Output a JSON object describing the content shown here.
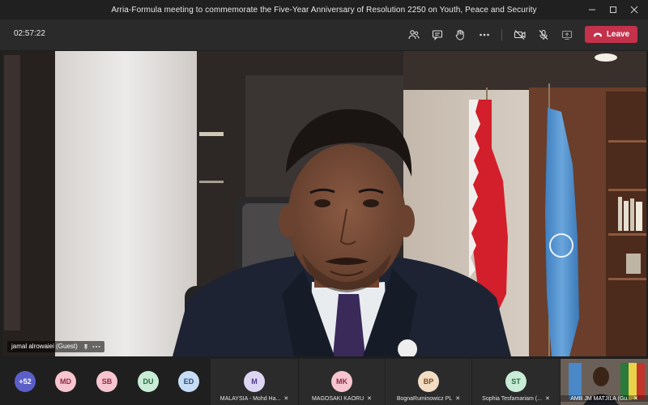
{
  "window": {
    "title": "Arria-Formula meeting to commemorate the Five-Year Anniversary of Resolution 2250 on Youth, Peace and Security"
  },
  "toolbar": {
    "timer": "02:57:22",
    "leave_label": "Leave",
    "icons": [
      "people-icon",
      "chat-icon",
      "raise-hand-icon",
      "more-icon",
      "camera-off-icon",
      "mic-off-icon",
      "share-icon"
    ],
    "leave_color": "#c4314b"
  },
  "main_speaker": {
    "name_tag": "jamal alrowaiei (Guest)"
  },
  "strip": {
    "overflow_count": "+52",
    "avatars": [
      {
        "initials": "MD",
        "bg": "#f7c5d0",
        "fg": "#8a2a45"
      },
      {
        "initials": "SB",
        "bg": "#f7c5d0",
        "fg": "#8a2a45"
      },
      {
        "initials": "DU",
        "bg": "#c9ecd6",
        "fg": "#2a6a45"
      },
      {
        "initials": "ED",
        "bg": "#c7dcf5",
        "fg": "#2a4a7a"
      }
    ],
    "tiles": [
      {
        "initials": "M",
        "name": "MALAYSIA - Mohd Ha...",
        "bg": "#ddd6f3",
        "fg": "#4b3a8a"
      },
      {
        "initials": "MK",
        "name": "MAGOSAKI KAORU",
        "bg": "#f7c5d0",
        "fg": "#8a2a45"
      },
      {
        "initials": "BP",
        "name": "BognaRuminowicz PL",
        "bg": "#f3dcc4",
        "fg": "#7a4a20"
      },
      {
        "initials": "ST",
        "name": "Sophia Tesfamariam (...",
        "bg": "#c9ecd6",
        "fg": "#2a6a45"
      }
    ],
    "video_tile_name": "AMB JM MATJILA (Gu..."
  }
}
